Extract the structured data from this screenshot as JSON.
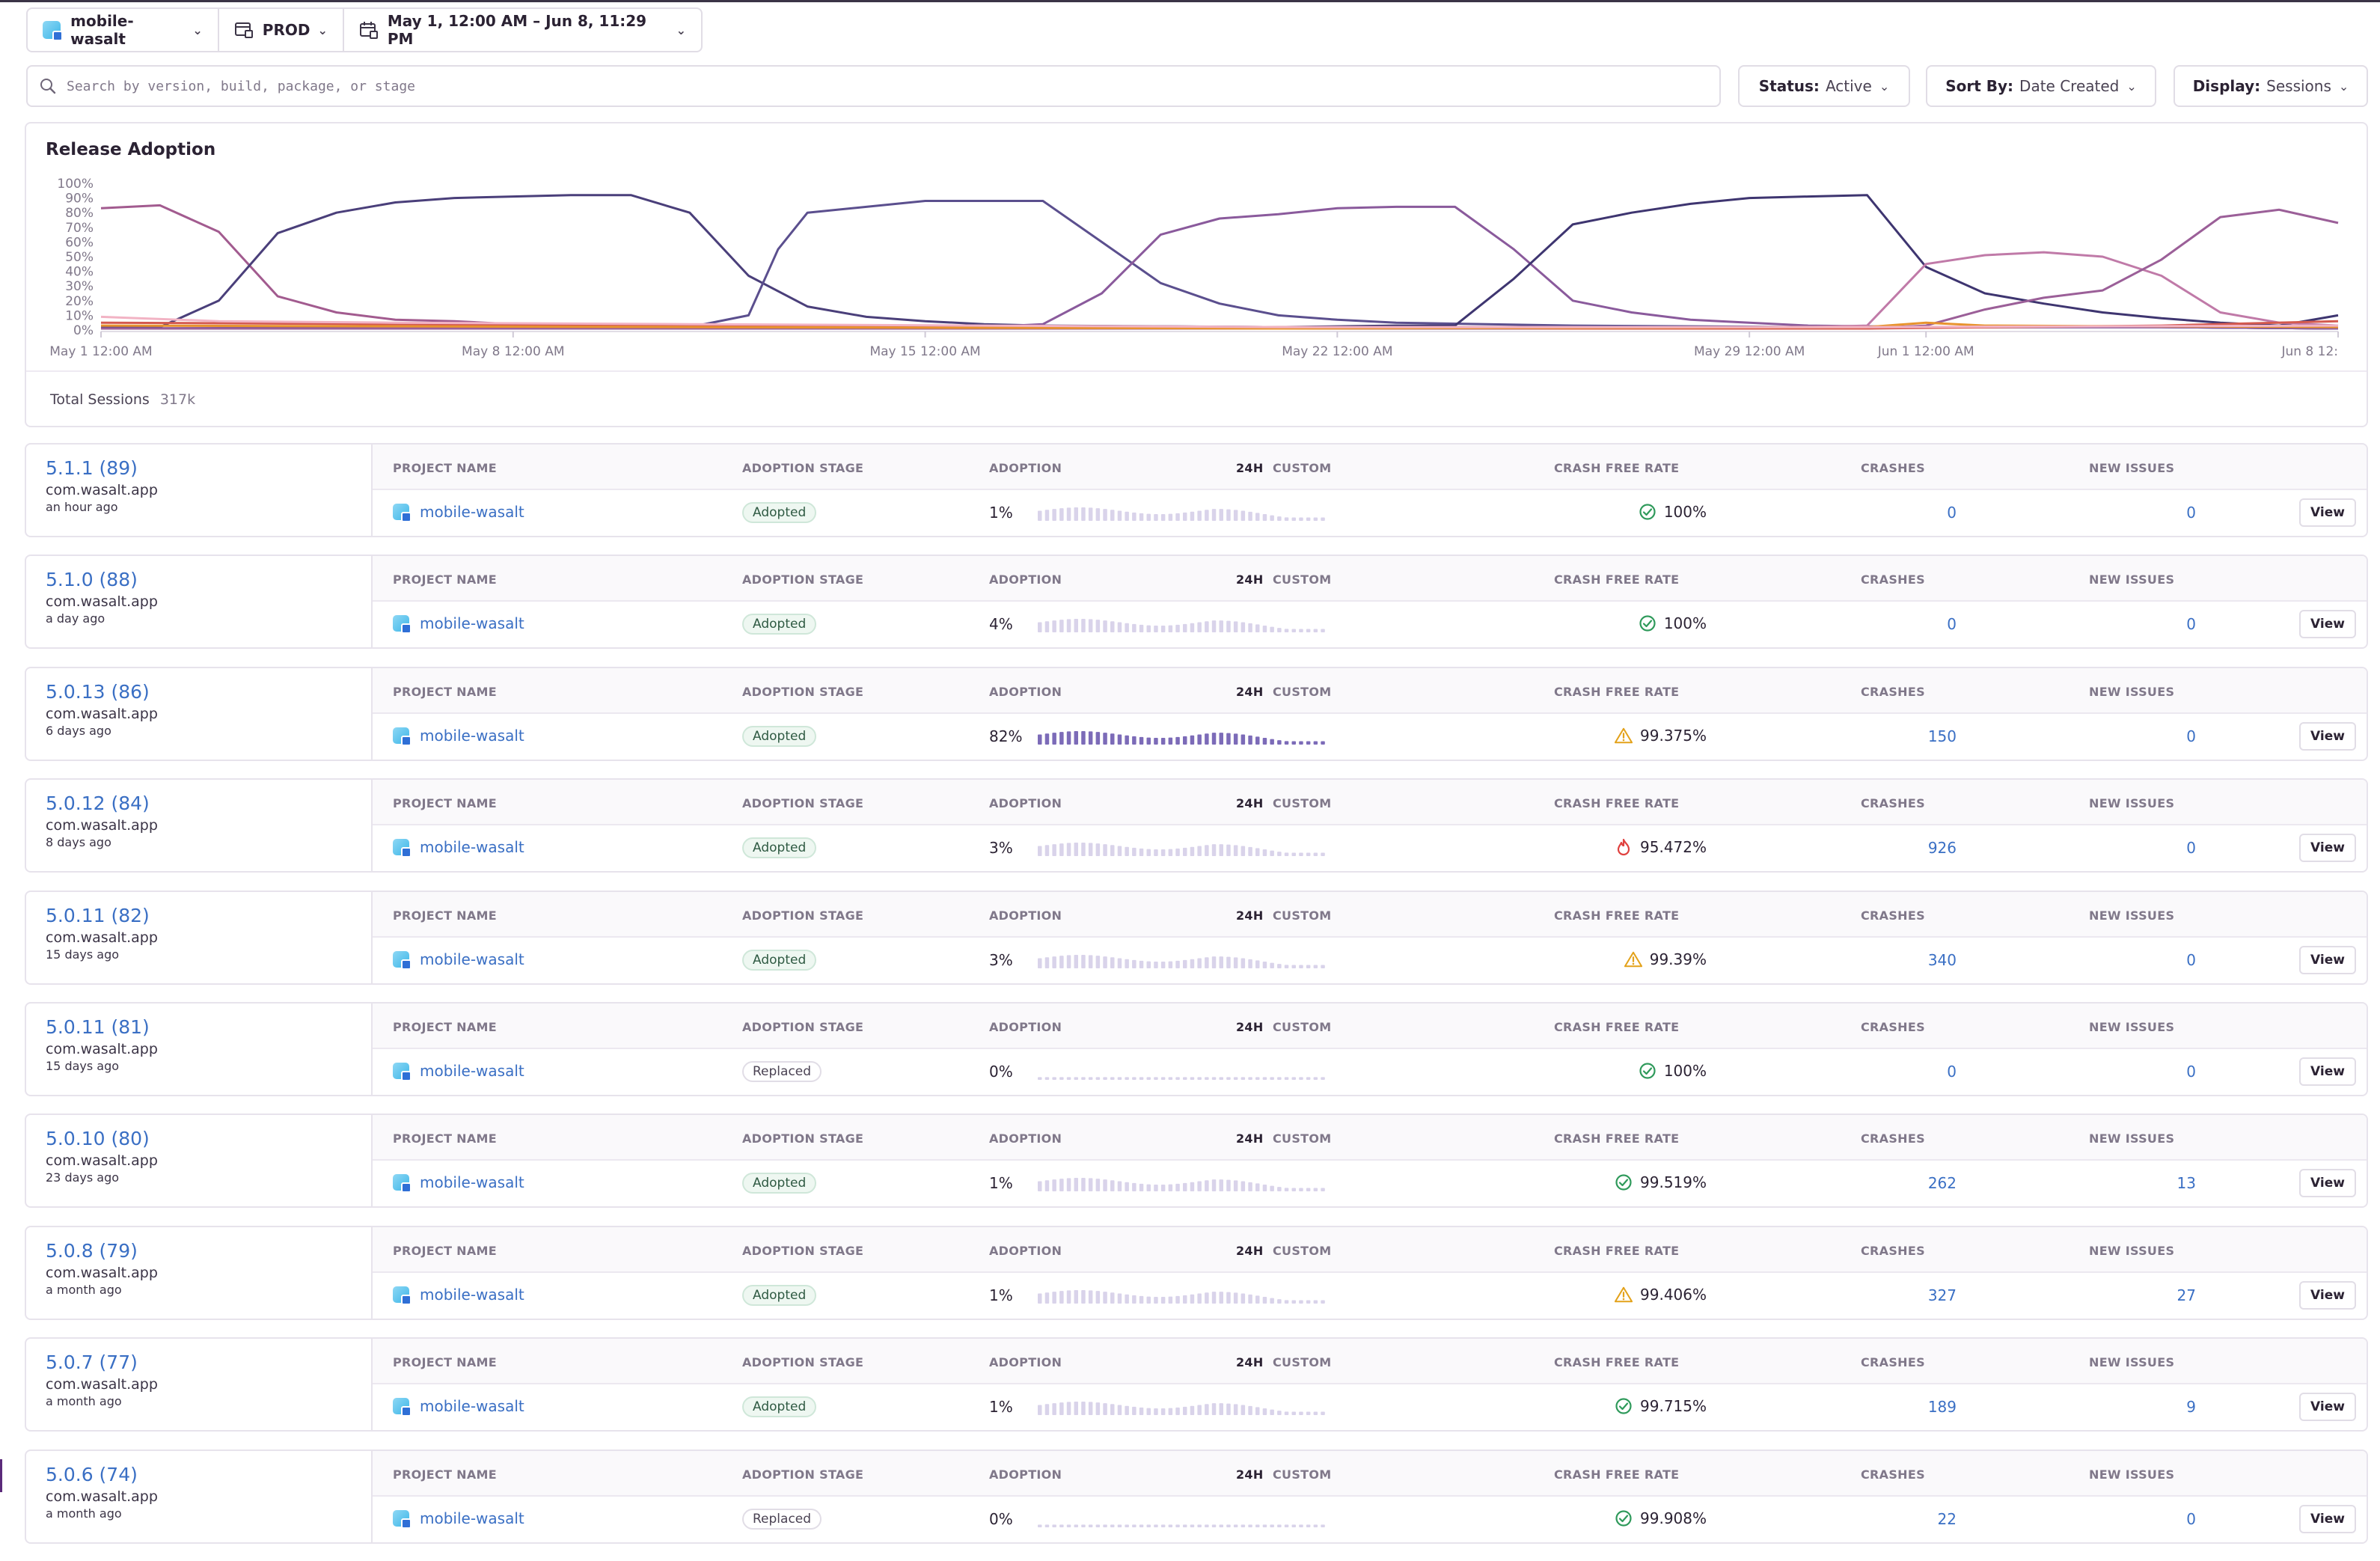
{
  "topbar": {
    "project": "mobile-wasalt",
    "environment": "PROD",
    "date_range": "May 1, 12:00 AM – Jun 8, 11:29 PM"
  },
  "search": {
    "placeholder": "Search by version, build, package, or stage"
  },
  "filters": {
    "status_label": "Status:",
    "status_value": "Active",
    "sort_label": "Sort By:",
    "sort_value": "Date Created",
    "display_label": "Display:",
    "display_value": "Sessions"
  },
  "chart_panel": {
    "total_label": "Total Sessions",
    "total_value": "317k"
  },
  "chart_data": {
    "type": "line",
    "title": "Release Adoption",
    "y_ticks": [
      "100%",
      "90%",
      "80%",
      "70%",
      "60%",
      "50%",
      "40%",
      "30%",
      "20%",
      "10%",
      "0%"
    ],
    "ylim": [
      0,
      100
    ],
    "x_ticks": [
      {
        "label": "May 1 12:00 AM",
        "day": 0
      },
      {
        "label": "May 8 12:00 AM",
        "day": 7
      },
      {
        "label": "May 15 12:00 AM",
        "day": 14
      },
      {
        "label": "May 22 12:00 AM",
        "day": 21
      },
      {
        "label": "May 29 12:00 AM",
        "day": 28
      },
      {
        "label": "Jun 1 12:00 AM",
        "day": 31
      },
      {
        "label": "Jun 8 12:",
        "day": 38
      }
    ],
    "grid": false,
    "series": [
      {
        "color": "#a25b8f",
        "points": [
          [
            0,
            83
          ],
          [
            1,
            85
          ],
          [
            2,
            67
          ],
          [
            3,
            23
          ],
          [
            4,
            12
          ],
          [
            5,
            7
          ],
          [
            6,
            6
          ],
          [
            7,
            4
          ],
          [
            10,
            3
          ],
          [
            15,
            3
          ],
          [
            20,
            2
          ],
          [
            25,
            2
          ],
          [
            29,
            2
          ],
          [
            31,
            2
          ],
          [
            35,
            2
          ],
          [
            38,
            1
          ]
        ]
      },
      {
        "color": "#4a3f7a",
        "points": [
          [
            0,
            2
          ],
          [
            1,
            2
          ],
          [
            2,
            20
          ],
          [
            3,
            66
          ],
          [
            4,
            80
          ],
          [
            5,
            87
          ],
          [
            6,
            90
          ],
          [
            7,
            91
          ],
          [
            8,
            92
          ],
          [
            9,
            92
          ],
          [
            10,
            80
          ],
          [
            11,
            37
          ],
          [
            12,
            16
          ],
          [
            13,
            9
          ],
          [
            14,
            6
          ],
          [
            15,
            4
          ],
          [
            16,
            3
          ],
          [
            20,
            2
          ],
          [
            25,
            2
          ],
          [
            29,
            2
          ],
          [
            31,
            2
          ],
          [
            35,
            2
          ],
          [
            38,
            1
          ]
        ]
      },
      {
        "color": "#5b4f8e",
        "points": [
          [
            0,
            1
          ],
          [
            10,
            2
          ],
          [
            11,
            10
          ],
          [
            11.5,
            55
          ],
          [
            12,
            80
          ],
          [
            13,
            84
          ],
          [
            14,
            88
          ],
          [
            16,
            88
          ],
          [
            17,
            60
          ],
          [
            18,
            32
          ],
          [
            19,
            18
          ],
          [
            20,
            10
          ],
          [
            21,
            7
          ],
          [
            22,
            5
          ],
          [
            25,
            3
          ],
          [
            29,
            2
          ],
          [
            31,
            2
          ],
          [
            35,
            2
          ],
          [
            38,
            1
          ]
        ]
      },
      {
        "color": "#8a5a9c",
        "points": [
          [
            0,
            1
          ],
          [
            15,
            2
          ],
          [
            16,
            4
          ],
          [
            17,
            25
          ],
          [
            18,
            65
          ],
          [
            19,
            76
          ],
          [
            20,
            79
          ],
          [
            21,
            83
          ],
          [
            22,
            84
          ],
          [
            23,
            84
          ],
          [
            24,
            55
          ],
          [
            25,
            20
          ],
          [
            26,
            12
          ],
          [
            27,
            7
          ],
          [
            28,
            5
          ],
          [
            29,
            3
          ],
          [
            31,
            2
          ],
          [
            35,
            2
          ],
          [
            38,
            1
          ]
        ]
      },
      {
        "color": "#3e3570",
        "points": [
          [
            0,
            1
          ],
          [
            20,
            2
          ],
          [
            22,
            3
          ],
          [
            23,
            3
          ],
          [
            24,
            35
          ],
          [
            25,
            72
          ],
          [
            26,
            80
          ],
          [
            27,
            86
          ],
          [
            28,
            90
          ],
          [
            29,
            91
          ],
          [
            30,
            92
          ],
          [
            31,
            43
          ],
          [
            32,
            25
          ],
          [
            33,
            18
          ],
          [
            34,
            12
          ],
          [
            35,
            8
          ],
          [
            36,
            5
          ],
          [
            37,
            3
          ],
          [
            38,
            10
          ]
        ]
      },
      {
        "color": "#c07aa8",
        "points": [
          [
            0,
            1
          ],
          [
            25,
            1
          ],
          [
            29,
            2
          ],
          [
            30,
            3
          ],
          [
            31,
            45
          ],
          [
            32,
            51
          ],
          [
            33,
            53
          ],
          [
            34,
            50
          ],
          [
            35,
            37
          ],
          [
            36,
            12
          ],
          [
            37,
            5
          ],
          [
            38,
            3
          ]
        ]
      },
      {
        "color": "#9b5f98",
        "points": [
          [
            0,
            1
          ],
          [
            30,
            1
          ],
          [
            31,
            3
          ],
          [
            32,
            14
          ],
          [
            33,
            22
          ],
          [
            34,
            27
          ],
          [
            35,
            48
          ],
          [
            36,
            77
          ],
          [
            37,
            82
          ],
          [
            38,
            73
          ]
        ]
      },
      {
        "color": "#d45a4f",
        "points": [
          [
            0,
            5
          ],
          [
            5,
            4
          ],
          [
            10,
            3
          ],
          [
            15,
            2
          ],
          [
            20,
            2
          ],
          [
            25,
            1
          ],
          [
            30,
            1
          ],
          [
            35,
            3
          ],
          [
            38,
            6
          ]
        ]
      },
      {
        "color": "#e8932e",
        "points": [
          [
            0,
            3
          ],
          [
            10,
            2
          ],
          [
            20,
            1
          ],
          [
            30,
            2
          ],
          [
            31,
            5
          ],
          [
            32,
            3
          ],
          [
            38,
            2
          ]
        ]
      },
      {
        "color": "#f2b3c4",
        "points": [
          [
            0,
            9
          ],
          [
            2,
            6
          ],
          [
            5,
            5
          ],
          [
            10,
            4
          ],
          [
            15,
            3
          ],
          [
            20,
            2
          ],
          [
            25,
            2
          ],
          [
            30,
            2
          ],
          [
            38,
            3
          ]
        ]
      }
    ]
  },
  "table_headers": {
    "project_name": "PROJECT NAME",
    "adoption_stage": "ADOPTION STAGE",
    "adoption": "ADOPTION",
    "range_24h": "24H",
    "range_custom": "CUSTOM",
    "crash_free_rate": "CRASH FREE RATE",
    "crashes": "CRASHES",
    "new_issues": "NEW ISSUES"
  },
  "view_label": "View",
  "releases": [
    {
      "version": "5.1.1 (89)",
      "package": "com.wasalt.app",
      "age": "an hour ago",
      "project": "mobile-wasalt",
      "stage": "Adopted",
      "adoption": "1%",
      "adoption_value": 1,
      "crash_free": "100%",
      "status": "ok",
      "crashes": "0",
      "new_issues": "0"
    },
    {
      "version": "5.1.0 (88)",
      "package": "com.wasalt.app",
      "age": "a day ago",
      "project": "mobile-wasalt",
      "stage": "Adopted",
      "adoption": "4%",
      "adoption_value": 4,
      "crash_free": "100%",
      "status": "ok",
      "crashes": "0",
      "new_issues": "0"
    },
    {
      "version": "5.0.13 (86)",
      "package": "com.wasalt.app",
      "age": "6 days ago",
      "project": "mobile-wasalt",
      "stage": "Adopted",
      "adoption": "82%",
      "adoption_value": 82,
      "crash_free": "99.375%",
      "status": "warn",
      "crashes": "150",
      "new_issues": "0"
    },
    {
      "version": "5.0.12 (84)",
      "package": "com.wasalt.app",
      "age": "8 days ago",
      "project": "mobile-wasalt",
      "stage": "Adopted",
      "adoption": "3%",
      "adoption_value": 3,
      "crash_free": "95.472%",
      "status": "fire",
      "crashes": "926",
      "new_issues": "0"
    },
    {
      "version": "5.0.11 (82)",
      "package": "com.wasalt.app",
      "age": "15 days ago",
      "project": "mobile-wasalt",
      "stage": "Adopted",
      "adoption": "3%",
      "adoption_value": 3,
      "crash_free": "99.39%",
      "status": "warn",
      "crashes": "340",
      "new_issues": "0"
    },
    {
      "version": "5.0.11 (81)",
      "package": "com.wasalt.app",
      "age": "15 days ago",
      "project": "mobile-wasalt",
      "stage": "Replaced",
      "adoption": "0%",
      "adoption_value": 0,
      "crash_free": "100%",
      "status": "ok",
      "crashes": "0",
      "new_issues": "0"
    },
    {
      "version": "5.0.10 (80)",
      "package": "com.wasalt.app",
      "age": "23 days ago",
      "project": "mobile-wasalt",
      "stage": "Adopted",
      "adoption": "1%",
      "adoption_value": 1,
      "crash_free": "99.519%",
      "status": "ok",
      "crashes": "262",
      "new_issues": "13"
    },
    {
      "version": "5.0.8 (79)",
      "package": "com.wasalt.app",
      "age": "a month ago",
      "project": "mobile-wasalt",
      "stage": "Adopted",
      "adoption": "1%",
      "adoption_value": 1,
      "crash_free": "99.406%",
      "status": "warn",
      "crashes": "327",
      "new_issues": "27"
    },
    {
      "version": "5.0.7 (77)",
      "package": "com.wasalt.app",
      "age": "a month ago",
      "project": "mobile-wasalt",
      "stage": "Adopted",
      "adoption": "1%",
      "adoption_value": 1,
      "crash_free": "99.715%",
      "status": "ok",
      "crashes": "189",
      "new_issues": "9"
    },
    {
      "version": "5.0.6 (74)",
      "package": "com.wasalt.app",
      "age": "a month ago",
      "project": "mobile-wasalt",
      "stage": "Replaced",
      "adoption": "0%",
      "adoption_value": 0,
      "crash_free": "99.908%",
      "status": "ok",
      "crashes": "22",
      "new_issues": "0"
    }
  ],
  "colors": {
    "link": "#3a6fc4",
    "ok": "#2f9a5b",
    "warn": "#e3a21a",
    "fire": "#e0413f",
    "spark": "#7c6bb8",
    "spark_light": "#d9d3ea"
  }
}
